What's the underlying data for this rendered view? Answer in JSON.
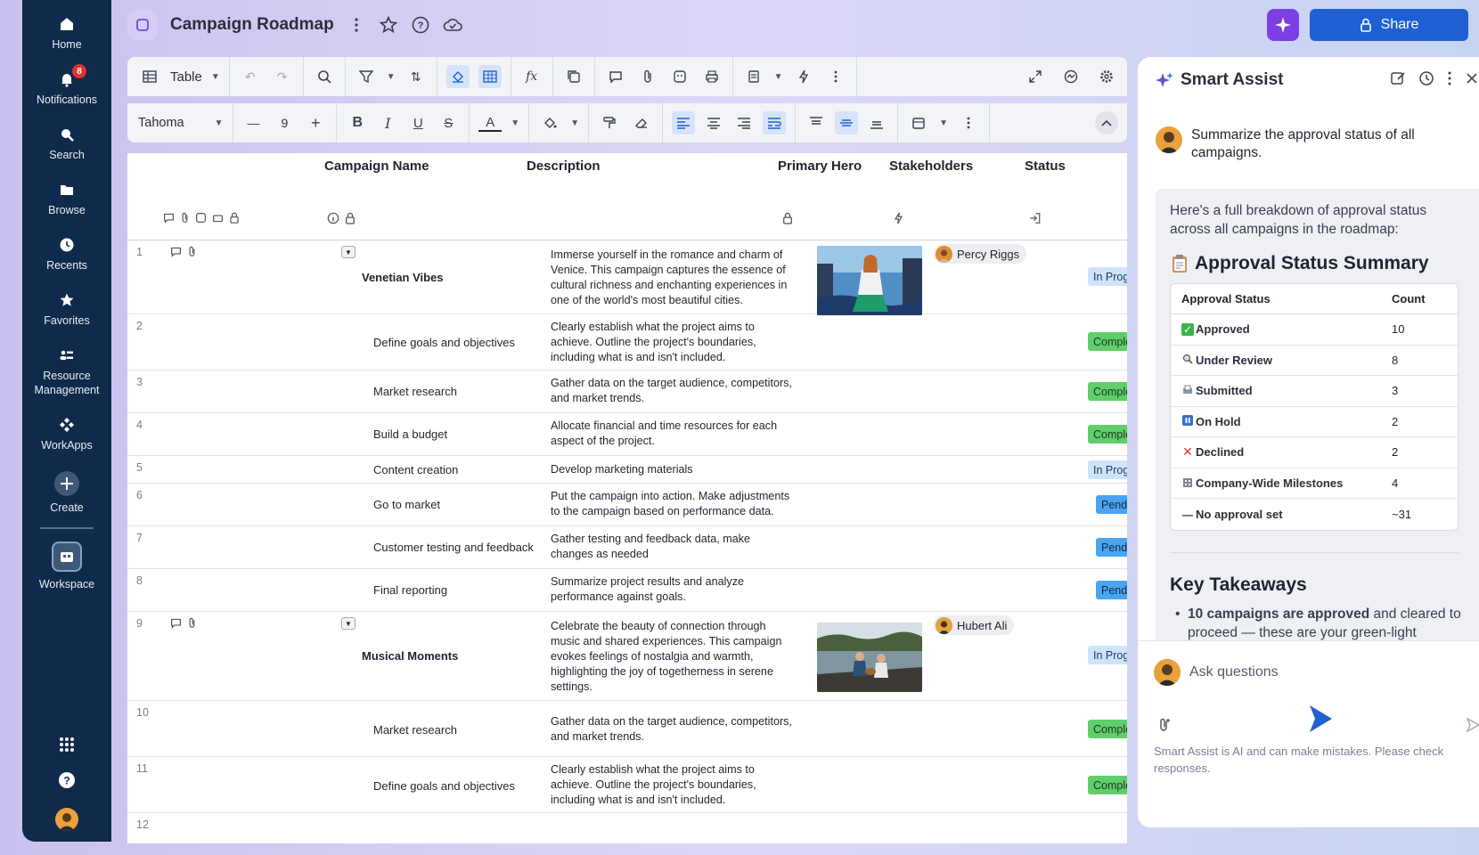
{
  "nav": {
    "items": [
      {
        "label": "Home"
      },
      {
        "label": "Notifications",
        "badge": "8"
      },
      {
        "label": "Search"
      },
      {
        "label": "Browse"
      },
      {
        "label": "Recents"
      },
      {
        "label": "Favorites"
      },
      {
        "label": "Resource Management"
      },
      {
        "label": "WorkApps"
      },
      {
        "label": "Create"
      }
    ],
    "workspace_label": "Workspace"
  },
  "header": {
    "title": "Campaign Roadmap",
    "share_label": "Share"
  },
  "toolbar": {
    "view_label": "Table",
    "font": "Tahoma",
    "font_size": "9"
  },
  "grid": {
    "columns": [
      "Campaign Name",
      "Description",
      "Primary Hero",
      "Stakeholders",
      "Status"
    ],
    "rows": [
      {
        "num": "1",
        "name": "Venetian Vibes",
        "desc": "Immerse yourself in the romance and charm of Venice. This campaign captures the essence of cultural richness and enchanting experiences in one of the world's most beautiful cities.",
        "stakeholder": "Percy Riggs",
        "status": "In Progress"
      },
      {
        "num": "2",
        "name": "Define goals and objectives",
        "desc": "Clearly establish what the project aims to achieve. Outline the project's boundaries, including what is and isn't included.",
        "status": "Complete"
      },
      {
        "num": "3",
        "name": "Market research",
        "desc": "Gather data on the target audience, competitors, and market trends.",
        "status": "Complete"
      },
      {
        "num": "4",
        "name": "Build a budget",
        "desc": "Allocate financial and time resources for each aspect of the project.",
        "status": "Complete"
      },
      {
        "num": "5",
        "name": "Content creation",
        "desc": "Develop marketing materials",
        "status": "In Progress"
      },
      {
        "num": "6",
        "name": "Go to market",
        "desc": "Put the campaign into action. Make adjustments to the campaign based on performance data.",
        "status": "Pending"
      },
      {
        "num": "7",
        "name": "Customer testing and feedback",
        "desc": "Gather testing and feedback data, make changes as needed",
        "status": "Pending"
      },
      {
        "num": "8",
        "name": "Final reporting",
        "desc": "Summarize project results and analyze performance against goals.",
        "status": "Pending"
      },
      {
        "num": "9",
        "name": "Musical Moments",
        "desc": "Celebrate the beauty of connection through music and shared experiences. This campaign evokes feelings of nostalgia and warmth, highlighting the joy of togetherness in serene settings.",
        "stakeholder": "Hubert Ali",
        "status": "In Progress"
      },
      {
        "num": "10",
        "name": "Market research",
        "desc": "Gather data on the target audience, competitors, and market trends.",
        "status": "Complete"
      },
      {
        "num": "11",
        "name": "Define goals and objectives",
        "desc": "Clearly establish what the project aims to achieve. Outline the project's boundaries, including what is and isn't included.",
        "status": "Complete"
      },
      {
        "num": "12"
      }
    ]
  },
  "assist": {
    "title": "Smart Assist",
    "user_message": "Summarize the approval status of all campaigns.",
    "reply_intro": "Here's a full breakdown of approval status across all campaigns in the roadmap:",
    "summary_title": "Approval Status Summary",
    "summary_headers": [
      "Approval Status",
      "Count"
    ],
    "summary_rows": [
      {
        "status": "Approved",
        "count": "10",
        "icon": "check-icon",
        "color": "#3bb34a"
      },
      {
        "status": "Under Review",
        "count": "8",
        "icon": "magnifier-icon",
        "color": "#6b7280"
      },
      {
        "status": "Submitted",
        "count": "3",
        "icon": "inbox-icon",
        "color": "#6b7280"
      },
      {
        "status": "On Hold",
        "count": "2",
        "icon": "pause-icon",
        "color": "#3b6fd1"
      },
      {
        "status": "Declined",
        "count": "2",
        "icon": "cross-icon",
        "color": "#e03131"
      },
      {
        "status": "Company-Wide Milestones",
        "count": "4",
        "icon": "building-icon",
        "color": "#6b7280"
      },
      {
        "status": "No approval set",
        "count": "~31",
        "icon": "dash-icon",
        "color": "#1f2430"
      }
    ],
    "takeaways_title": "Key Takeaways",
    "takeaway_bold": "10 campaigns are approved",
    "takeaway_rest": " and cleared to proceed — these are your green-light",
    "input_placeholder": "Ask questions",
    "disclaimer": "Smart Assist is AI and can make mistakes. Please check responses."
  }
}
